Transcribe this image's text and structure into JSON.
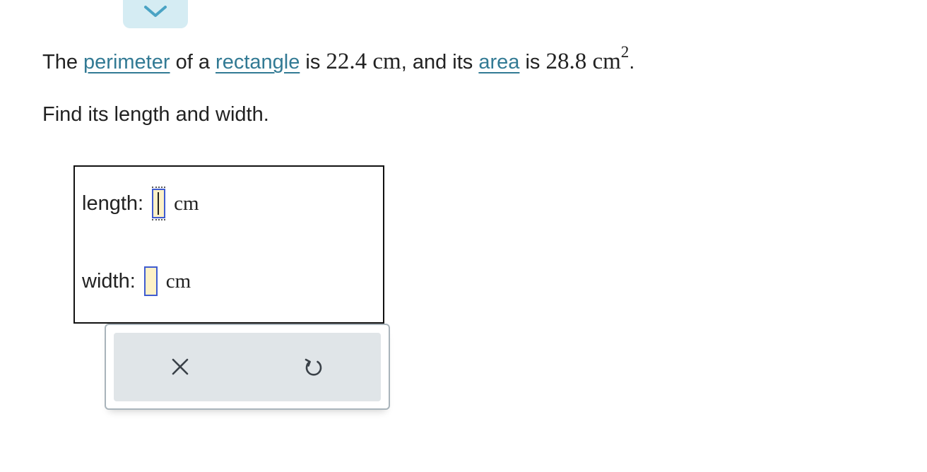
{
  "problem": {
    "part1": "The ",
    "link_perimeter": "perimeter",
    "part2": " of a ",
    "link_rectangle": "rectangle",
    "part3": " is ",
    "perimeter_value": "22.4 cm",
    "part4": ", and its ",
    "link_area": "area",
    "part5": " is ",
    "area_value": "28.8 cm",
    "area_exponent": "2",
    "part6": "."
  },
  "instruction": "Find its length and width.",
  "answers": {
    "length_label": "length:",
    "length_value": "",
    "length_unit": "cm",
    "width_label": "width:",
    "width_value": "",
    "width_unit": "cm"
  },
  "icons": {
    "collapse": "chevron-down-icon",
    "clear": "close-icon",
    "reset": "undo-icon"
  },
  "colors": {
    "link": "#327a94",
    "input_border": "#3f5cd0",
    "input_fill": "#fdf1c7",
    "tab": "#d5ecf3"
  }
}
